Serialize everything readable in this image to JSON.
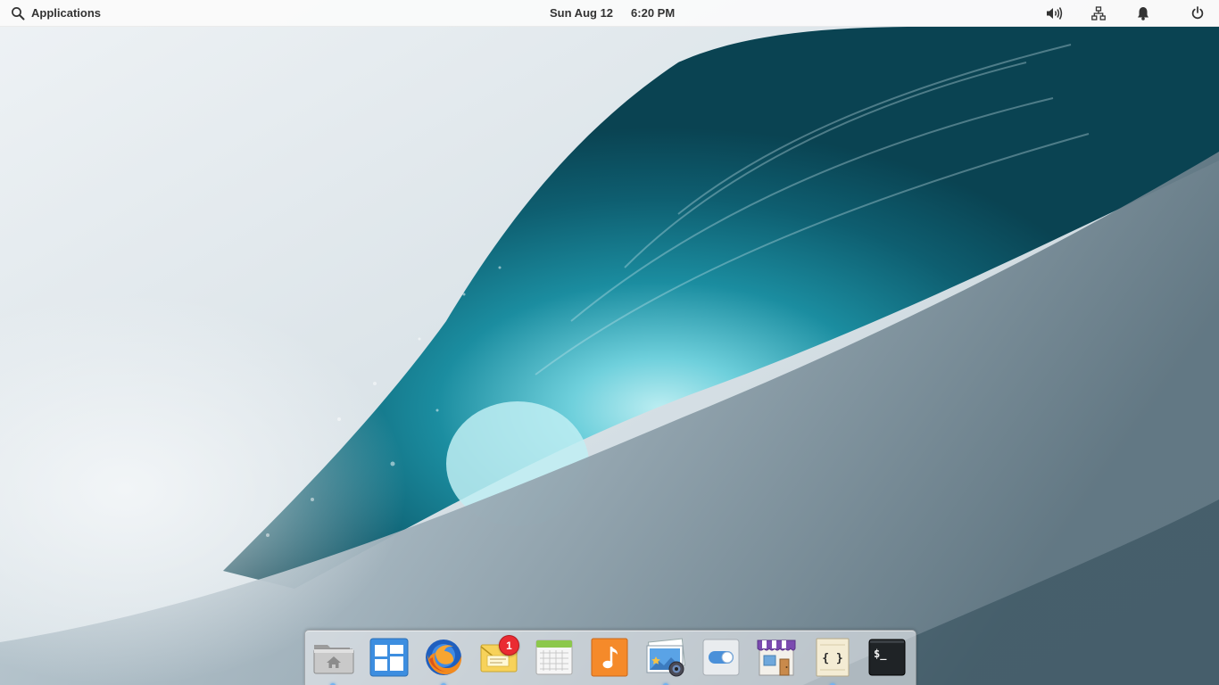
{
  "panel": {
    "applications_label": "Applications",
    "date": "Sun Aug 12",
    "time": "6:20 PM",
    "indicators": [
      "volume-icon",
      "network-icon",
      "notifications-icon",
      "power-icon"
    ]
  },
  "dock": {
    "items": [
      {
        "app": "Files",
        "icon": "folder-home-icon",
        "running": true
      },
      {
        "app": "Multitasking View",
        "icon": "multitasking-icon",
        "running": false
      },
      {
        "app": "Firefox",
        "icon": "firefox-icon",
        "running": true
      },
      {
        "app": "Mail",
        "icon": "mail-icon",
        "running": false,
        "badge": "1"
      },
      {
        "app": "Calendar",
        "icon": "calendar-icon",
        "running": false
      },
      {
        "app": "Music",
        "icon": "music-icon",
        "running": false
      },
      {
        "app": "Photos",
        "icon": "photos-icon",
        "running": true
      },
      {
        "app": "System Settings",
        "icon": "settings-toggle-icon",
        "running": false
      },
      {
        "app": "AppCenter",
        "icon": "appcenter-store-icon",
        "running": false
      },
      {
        "app": "Code",
        "icon": "code-editor-icon",
        "running": true
      },
      {
        "app": "Terminal",
        "icon": "terminal-icon",
        "running": false
      }
    ],
    "terminal_prompt": "$_",
    "code_glyph": "{ }"
  },
  "colors": {
    "panel_bg": "#fafafa",
    "running_indicator": "#73b4f0",
    "badge": "#ea2b32",
    "wave_dark": "#0d4d5e",
    "wave_light": "#7fd3e0"
  }
}
